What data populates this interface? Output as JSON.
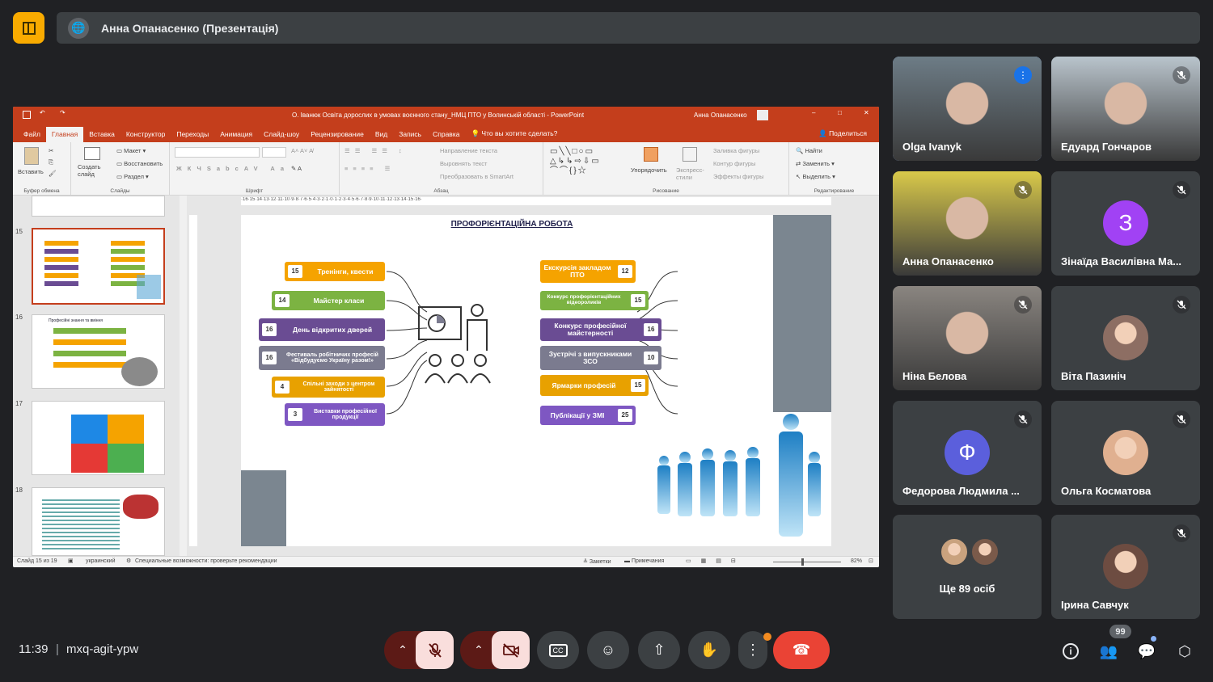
{
  "meeting": {
    "presenter_label": "Анна Опанасенко (Презентація)",
    "time": "11:39",
    "separator": "|",
    "code": "mxq-agit-ypw",
    "participants_badge": "99"
  },
  "ppt": {
    "window_title": "О. Іванюк Освіта дорослих в умовах воєнного стану_НМЦ ПТО у Волинській області  -  PowerPoint",
    "user_name": "Анна Опанасенко",
    "tabs": [
      "Файл",
      "Главная",
      "Вставка",
      "Конструктор",
      "Переходы",
      "Анимация",
      "Слайд-шоу",
      "Рецензирование",
      "Вид",
      "Запись",
      "Справка"
    ],
    "tell_me": "Что вы хотите сделать?",
    "share": "Поделиться",
    "ribbon": {
      "paste": "Вставить",
      "clipboard": "Буфер обмена",
      "create_slide": "Создать слайд",
      "layout": "Макет",
      "reset": "Восстановить",
      "section": "Раздел",
      "slides": "Слайды",
      "font": "Шрифт",
      "paragraph": "Абзац",
      "text_direction": "Направление текста",
      "align_text": "Выровнять текст",
      "smartart": "Преобразовать в SmartArt",
      "arrange": "Упорядочить",
      "quick_styles": "Экспресс-стили",
      "fill": "Заливка фигуры",
      "outline": "Контур фигуры",
      "effects": "Эффекты фигуры",
      "drawing": "Рисование",
      "find": "Найти",
      "replace": "Заменить",
      "select": "Выделить",
      "editing": "Редактирование"
    },
    "thumb_numbers": [
      "15",
      "16",
      "17",
      "18"
    ],
    "thumb16_title": "Професійні знання та вміння",
    "status_slide": "Слайд 15 из 19",
    "status_lang": "украинский",
    "status_access": "Специальные возможности: проверьте рекомендации",
    "notes": "Заметки",
    "comments": "Примечания",
    "zoom": "82%"
  },
  "slide": {
    "title": "ПРОФОРІЄНТАЦІЙНА РОБОТА",
    "left_items": [
      {
        "num": "15",
        "label": "Тренінги, квести",
        "color": "#f5a300"
      },
      {
        "num": "14",
        "label": "Майстер класи",
        "color": "#7cb342"
      },
      {
        "num": "16",
        "label": "День відкритих дверей",
        "color": "#6a4c93"
      },
      {
        "num": "16",
        "label": "Фестиваль робітничих професій «Відбудуємо Україну разом!»",
        "color": "#7b7b8f"
      },
      {
        "num": "4",
        "label": "Спільні заходи з центром зайнятості",
        "color": "#e8a100"
      },
      {
        "num": "3",
        "label": "Виставки професійної продукції",
        "color": "#7e57c2"
      }
    ],
    "right_items": [
      {
        "num": "12",
        "label": "Екскурсія закладом ПТО",
        "color": "#f5a300"
      },
      {
        "num": "15",
        "label": "Конкурс профорієнтаційних відеороликів",
        "color": "#7cb342"
      },
      {
        "num": "16",
        "label": "Конкурс професійної майстерності",
        "color": "#6a4c93"
      },
      {
        "num": "10",
        "label": "Зустрічі з випускниками ЗСО",
        "color": "#7b7b8f"
      },
      {
        "num": "15",
        "label": "Ярмарки професій",
        "color": "#e8a100"
      },
      {
        "num": "25",
        "label": "Публікації у ЗМІ",
        "color": "#7e57c2"
      }
    ]
  },
  "participants": [
    {
      "name": "Olga Ivanyk",
      "type": "video",
      "speaking": true,
      "bg": "#6d7c86"
    },
    {
      "name": "Едуард Гончаров",
      "type": "video",
      "muted": true,
      "bg": "#b9c4cc"
    },
    {
      "name": "Анна Опанасенко",
      "type": "video",
      "muted": true,
      "bg": "#d9c94a"
    },
    {
      "name": "Зінаїда Василівна Ма...",
      "type": "avatar",
      "letter": "З",
      "avatar_color": "#a142f4",
      "muted": true
    },
    {
      "name": "Ніна Белова",
      "type": "video",
      "muted": true,
      "bg": "#8a8580"
    },
    {
      "name": "Віта Пазиніч",
      "type": "photo",
      "muted": true,
      "avatar_color": "#8d6e63"
    },
    {
      "name": "Федорова Людмила ...",
      "type": "avatar",
      "letter": "Ф",
      "avatar_color": "#5b5fdc",
      "muted": true
    },
    {
      "name": "Ольга Косматова",
      "type": "photo",
      "muted": true,
      "avatar_color": "#e0b090"
    },
    {
      "name": "Ще 89 осіб",
      "type": "more"
    },
    {
      "name": "Ірина Савчук",
      "type": "photo",
      "muted": true,
      "avatar_color": "#6d4c41"
    }
  ]
}
